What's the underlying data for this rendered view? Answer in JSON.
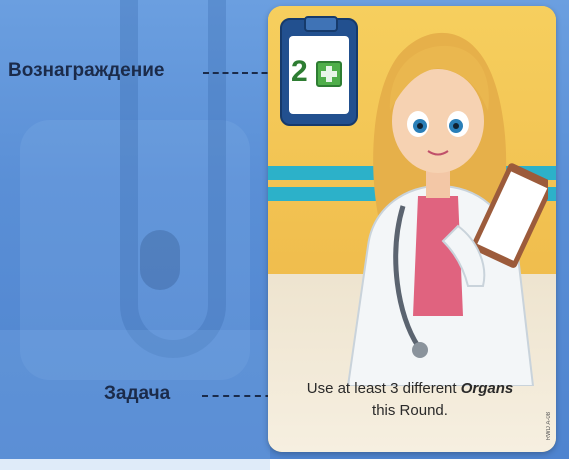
{
  "callouts": {
    "reward_label": "Вознаграждение",
    "task_label": "Задача"
  },
  "card": {
    "reward_value": "2",
    "reward_icon": "green-cross-icon",
    "task_text_before": "Use at least 3 different ",
    "task_text_emphasis": "Organs",
    "task_text_after": "this Round.",
    "card_code": "RWD A-08"
  },
  "colors": {
    "background": "#5a8fd6",
    "card_wall": "#f4c757",
    "stripe": "#2cb1c9",
    "reward_green": "#4fae4a",
    "label_text": "#1b2b4a"
  }
}
